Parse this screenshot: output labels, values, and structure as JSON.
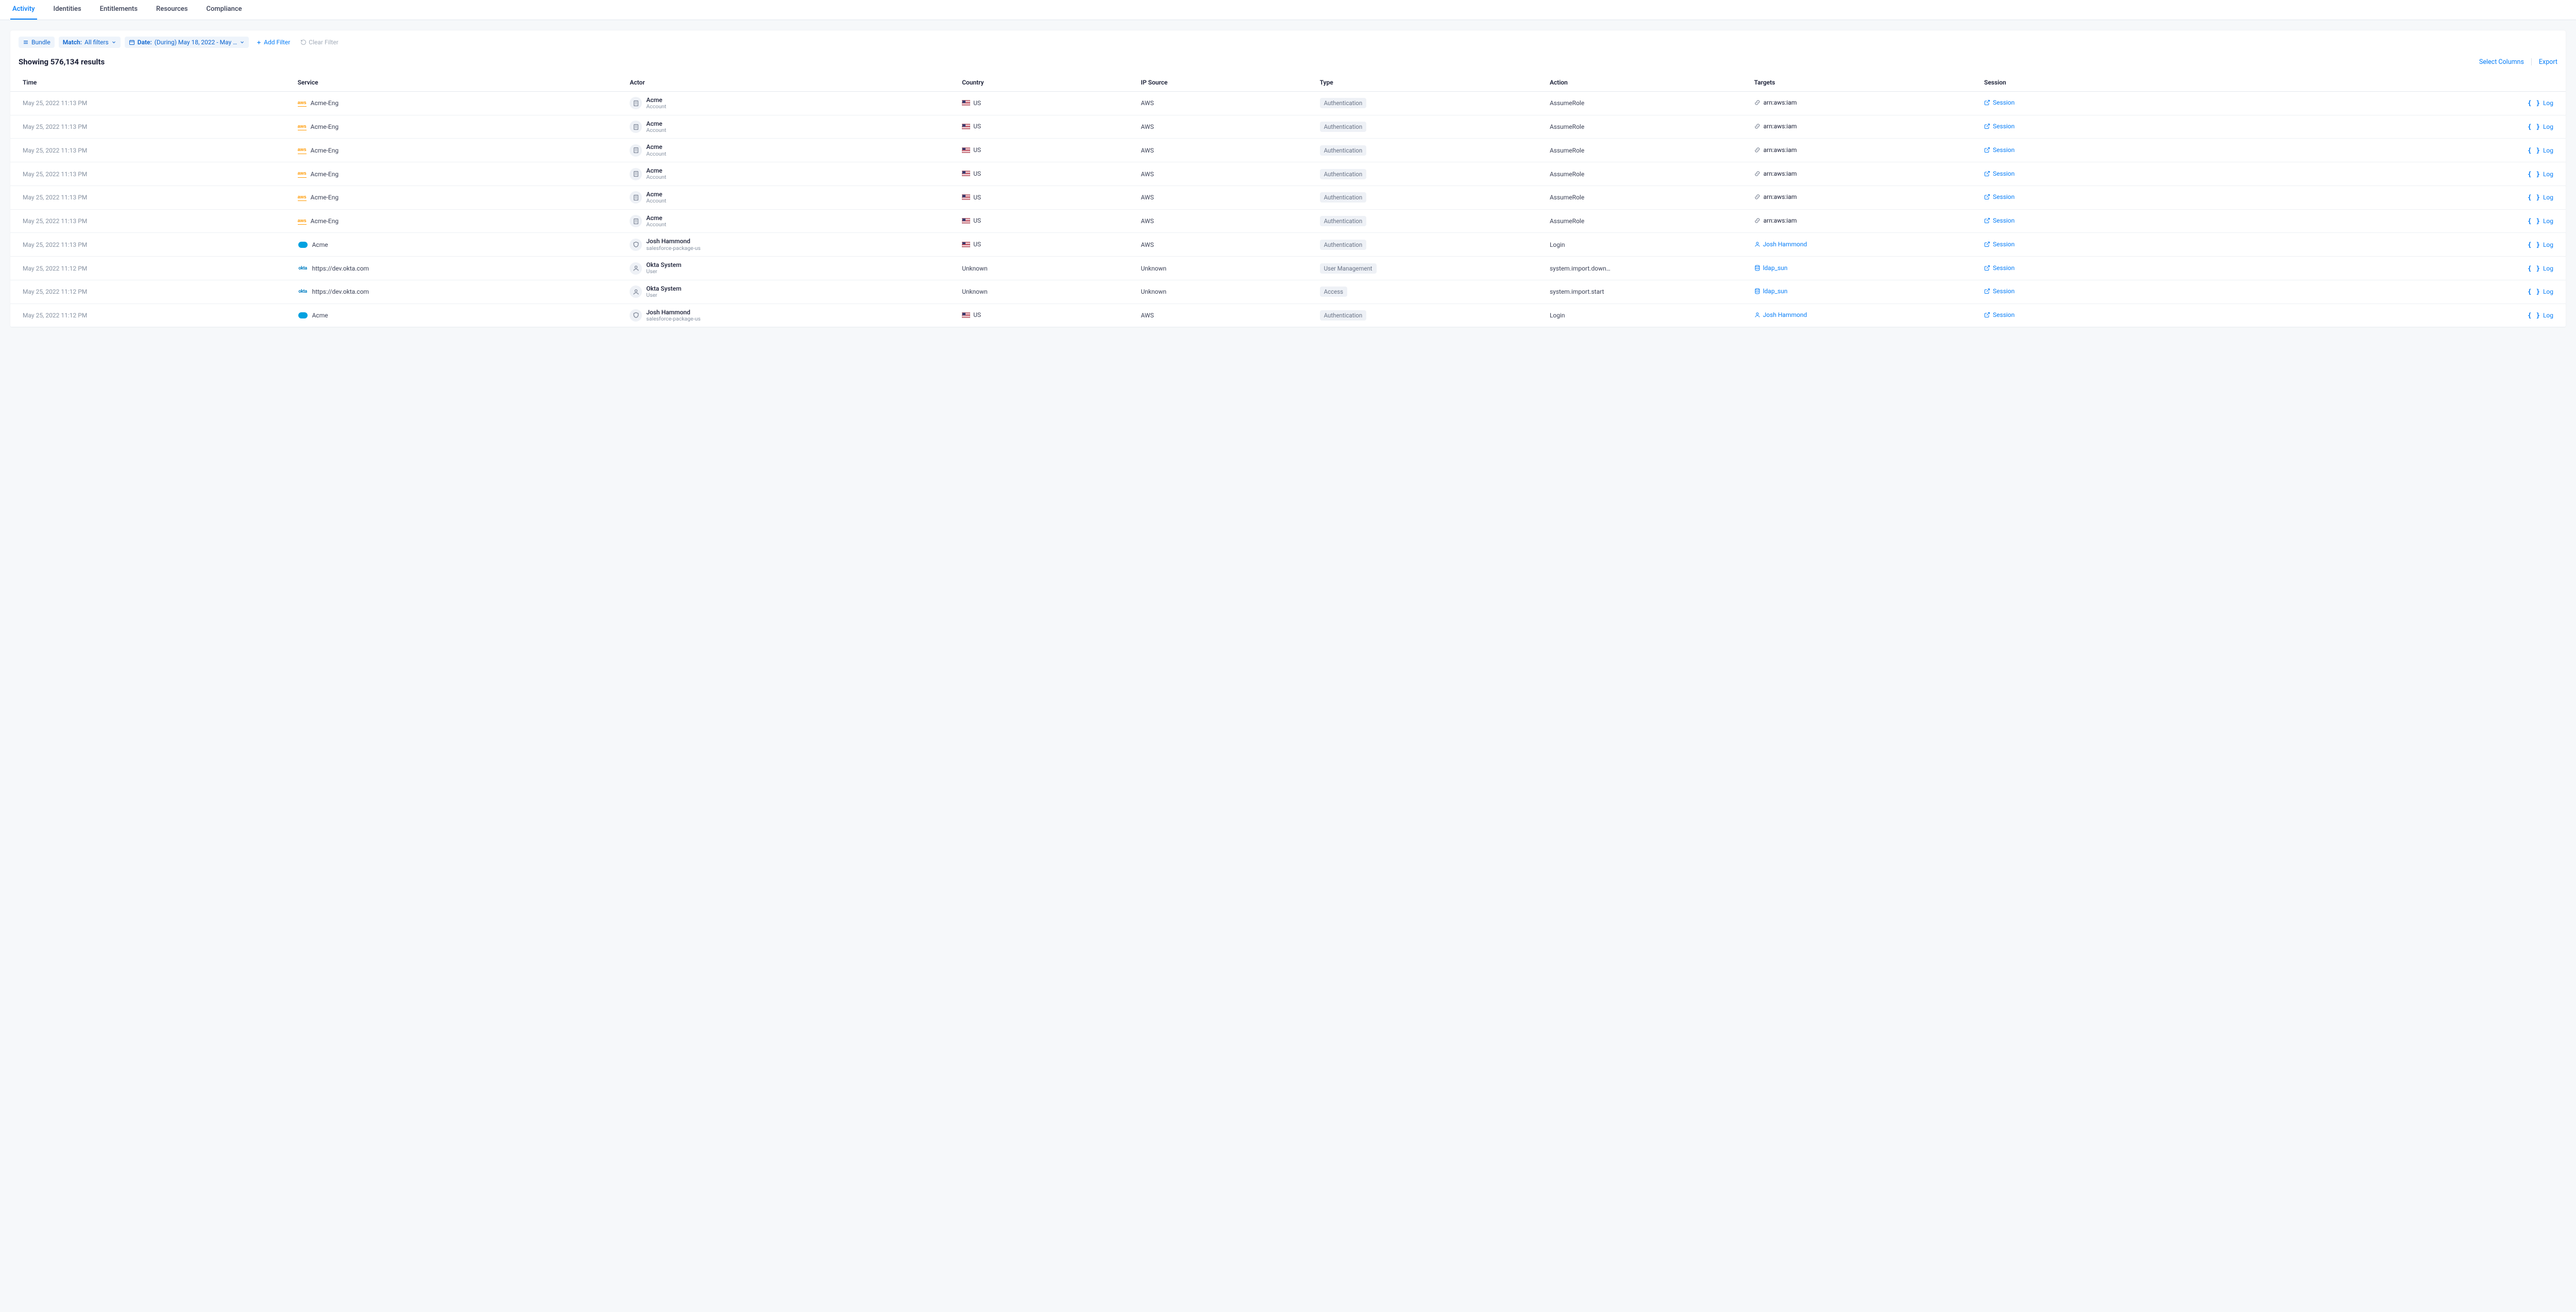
{
  "tabs": [
    {
      "label": "Activity",
      "active": true
    },
    {
      "label": "Identities",
      "active": false
    },
    {
      "label": "Entitlements",
      "active": false
    },
    {
      "label": "Resources",
      "active": false
    },
    {
      "label": "Compliance",
      "active": false
    }
  ],
  "filters": {
    "bundle_label": "Bundle",
    "match": {
      "key": "Match:",
      "value": "All filters"
    },
    "date": {
      "key": "Date:",
      "value": "(During) May 18, 2022 - May …"
    },
    "add_filter_label": "Add Filter",
    "clear_filter_label": "Clear Filter"
  },
  "results_header": "Showing 576,134 results",
  "results_actions": {
    "select_columns": "Select Columns",
    "export": "Export"
  },
  "columns": [
    "Time",
    "Service",
    "Actor",
    "Country",
    "IP Source",
    "Type",
    "Action",
    "Targets",
    "Session"
  ],
  "session_link_label": "Session",
  "log_link_label": "Log",
  "rows": [
    {
      "time": "May 25, 2022 11:13 PM",
      "service": {
        "logo": "aws",
        "name": "Acme-Eng"
      },
      "actor": {
        "icon": "building",
        "name": "Acme",
        "sub": "Account"
      },
      "country": {
        "flag": true,
        "label": "US"
      },
      "ip": "AWS",
      "type": "Authentication",
      "action": "AssumeRole",
      "target": {
        "icon": "chain",
        "label": "arn:aws:iam"
      }
    },
    {
      "time": "May 25, 2022 11:13 PM",
      "service": {
        "logo": "aws",
        "name": "Acme-Eng"
      },
      "actor": {
        "icon": "building",
        "name": "Acme",
        "sub": "Account"
      },
      "country": {
        "flag": true,
        "label": "US"
      },
      "ip": "AWS",
      "type": "Authentication",
      "action": "AssumeRole",
      "target": {
        "icon": "chain",
        "label": "arn:aws:iam"
      }
    },
    {
      "time": "May 25, 2022 11:13 PM",
      "service": {
        "logo": "aws",
        "name": "Acme-Eng"
      },
      "actor": {
        "icon": "building",
        "name": "Acme",
        "sub": "Account"
      },
      "country": {
        "flag": true,
        "label": "US"
      },
      "ip": "AWS",
      "type": "Authentication",
      "action": "AssumeRole",
      "target": {
        "icon": "chain",
        "label": "arn:aws:iam"
      }
    },
    {
      "time": "May 25, 2022 11:13 PM",
      "service": {
        "logo": "aws",
        "name": "Acme-Eng"
      },
      "actor": {
        "icon": "building",
        "name": "Acme",
        "sub": "Account"
      },
      "country": {
        "flag": true,
        "label": "US"
      },
      "ip": "AWS",
      "type": "Authentication",
      "action": "AssumeRole",
      "target": {
        "icon": "chain",
        "label": "arn:aws:iam"
      }
    },
    {
      "time": "May 25, 2022 11:13 PM",
      "service": {
        "logo": "aws",
        "name": "Acme-Eng"
      },
      "actor": {
        "icon": "building",
        "name": "Acme",
        "sub": "Account"
      },
      "country": {
        "flag": true,
        "label": "US"
      },
      "ip": "AWS",
      "type": "Authentication",
      "action": "AssumeRole",
      "target": {
        "icon": "chain",
        "label": "arn:aws:iam"
      }
    },
    {
      "time": "May 25, 2022 11:13 PM",
      "service": {
        "logo": "aws",
        "name": "Acme-Eng"
      },
      "actor": {
        "icon": "building",
        "name": "Acme",
        "sub": "Account"
      },
      "country": {
        "flag": true,
        "label": "US"
      },
      "ip": "AWS",
      "type": "Authentication",
      "action": "AssumeRole",
      "target": {
        "icon": "chain",
        "label": "arn:aws:iam"
      }
    },
    {
      "time": "May 25, 2022 11:13 PM",
      "service": {
        "logo": "salesforce",
        "name": "Acme"
      },
      "actor": {
        "icon": "shield",
        "name": "Josh Hammond",
        "sub": "salesforce-package-us"
      },
      "country": {
        "flag": true,
        "label": "US"
      },
      "ip": "AWS",
      "type": "Authentication",
      "action": "Login",
      "target": {
        "icon": "user",
        "label": "Josh Hammond",
        "link": true
      }
    },
    {
      "time": "May 25, 2022 11:12 PM",
      "service": {
        "logo": "okta",
        "name": "https://dev.okta.com"
      },
      "actor": {
        "icon": "person",
        "name": "Okta System",
        "sub": "User"
      },
      "country": {
        "flag": false,
        "label": "Unknown"
      },
      "ip": "Unknown",
      "type": "User Management",
      "action": "system.import.downl…",
      "target": {
        "icon": "db",
        "label": "ldap_sun",
        "link": true
      }
    },
    {
      "time": "May 25, 2022 11:12 PM",
      "service": {
        "logo": "okta",
        "name": "https://dev.okta.com"
      },
      "actor": {
        "icon": "person",
        "name": "Okta System",
        "sub": "User"
      },
      "country": {
        "flag": false,
        "label": "Unknown"
      },
      "ip": "Unknown",
      "type": "Access",
      "action": "system.import.start",
      "target": {
        "icon": "db",
        "label": "ldap_sun",
        "link": true
      }
    },
    {
      "time": "May 25, 2022 11:12 PM",
      "service": {
        "logo": "salesforce",
        "name": "Acme"
      },
      "actor": {
        "icon": "shield",
        "name": "Josh Hammond",
        "sub": "salesforce-package-us"
      },
      "country": {
        "flag": true,
        "label": "US"
      },
      "ip": "AWS",
      "type": "Authentication",
      "action": "Login",
      "target": {
        "icon": "user",
        "label": "Josh Hammond",
        "link": true
      }
    }
  ]
}
